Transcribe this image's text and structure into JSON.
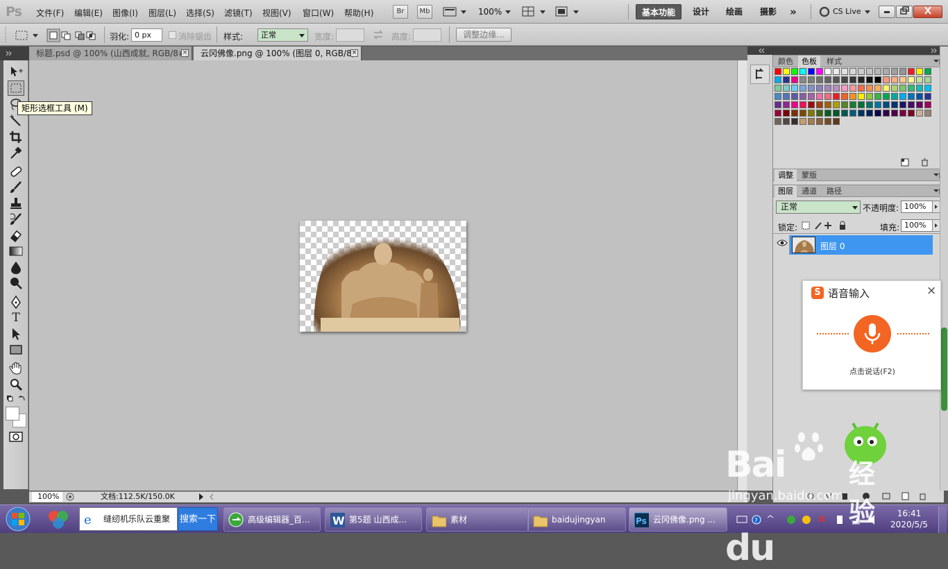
{
  "menubar": {
    "logo": "Ps",
    "items": [
      "文件(F)",
      "编辑(E)",
      "图像(I)",
      "图层(L)",
      "选择(S)",
      "滤镜(T)",
      "视图(V)",
      "窗口(W)",
      "帮助(H)"
    ],
    "br_label": "Br",
    "mb_label": "Mb",
    "zoom": "100%",
    "workspaces": [
      "基本功能",
      "设计",
      "绘画",
      "摄影"
    ],
    "overflow": "»",
    "cslive": "CS Live"
  },
  "options": {
    "feather_label": "羽化:",
    "feather_value": "0 px",
    "antialias_label": "消除锯齿",
    "style_label": "样式:",
    "style_value": "正常",
    "width_label": "宽度:",
    "height_label": "高度:",
    "refine_button": "调整边缘..."
  },
  "tabs": [
    {
      "title": "标题.psd @ 100% (山西成就, RGB/8#)"
    },
    {
      "title": "云冈佛像.png @ 100% (图层 0, RGB/8)"
    }
  ],
  "tooltip": "矩形选框工具 (M)",
  "status": {
    "zoom": "100%",
    "doc_info": "文档:112.5K/150.0K"
  },
  "panels": {
    "top_tabs": [
      "颜色",
      "色板",
      "样式"
    ],
    "adjust_tabs": [
      "调整",
      "蒙版"
    ],
    "layer_tabs": [
      "图层",
      "通道",
      "路径"
    ],
    "blend_mode": "正常",
    "opacity_label": "不透明度:",
    "opacity_value": "100%",
    "lock_label": "锁定:",
    "fill_label": "填充:",
    "fill_value": "100%",
    "layer_name": "图层 0"
  },
  "voice": {
    "title": "语音输入",
    "hint": "点击说话(F2)"
  },
  "taskbar": {
    "ie_text": "缝纫机乐队云重聚",
    "search_button": "搜索一下",
    "tasks": [
      "高级编辑器_百...",
      "第5题 山西成...",
      "素材",
      "baidujingyan",
      "云冈佛像.png ..."
    ],
    "time": "16:41",
    "date": "2020/5/5"
  },
  "watermark": {
    "brand": "Bai",
    "brand2": "du",
    "jingyan": "经验",
    "url": "jingyan.baidu.com"
  },
  "colors": {
    "accent_layer": "#3e96f0",
    "voice_mic": "#f26522",
    "blend_bg": "#c9e4c9"
  }
}
